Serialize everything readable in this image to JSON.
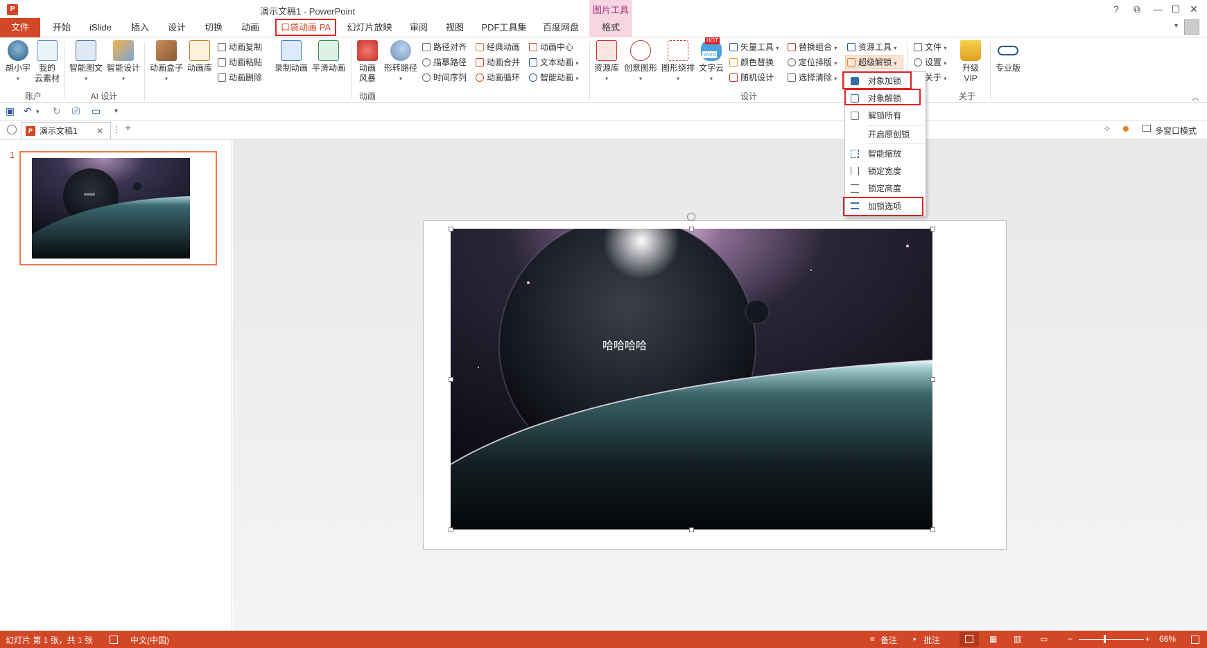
{
  "titlebar": {
    "title": "演示文稿1 - PowerPoint",
    "context_tab": "图片工具",
    "app_icon": "P"
  },
  "window_controls": {
    "help": "?",
    "restore_ribbon": "⧉",
    "minimize": "—",
    "maximize": "☐",
    "close": "✕"
  },
  "tabs": [
    "文件",
    "开始",
    "iSlide",
    "插入",
    "设计",
    "切换",
    "动画",
    "口袋动画 PA",
    "幻灯片放映",
    "审阅",
    "视图",
    "PDF工具集",
    "百度网盘",
    "格式"
  ],
  "ribbon": {
    "account": {
      "user": "胡小宇",
      "cloud_line1": "我的",
      "cloud_line2": "云素材",
      "group": "账户"
    },
    "ai": {
      "smart_text": "智能图文",
      "smart_design": "智能设计",
      "group": "AI 设计"
    },
    "anim": {
      "box": "动画盒子",
      "lib": "动画库",
      "copy": "动画复制",
      "paste": "动画粘贴",
      "del": "动画删除",
      "record": "录制动画",
      "smooth": "平滑动画",
      "storm_line1": "动画",
      "storm_line2": "风暴",
      "path": "形转路径",
      "align": "路径对齐",
      "trace": "描摹路径",
      "timeline": "时间序列",
      "classic": "经典动画",
      "merge": "动画合并",
      "loop": "动画循环",
      "center": "动画中心",
      "text": "文本动画",
      "smart": "智能动画",
      "group": "动画"
    },
    "design": {
      "res": "资源库",
      "creative": "创意图形",
      "shape": "图形绕排",
      "word": "文字云",
      "hot": "HOT",
      "word_badge": "word",
      "vector": "矢量工具",
      "color": "颜色替换",
      "random": "随机设计",
      "replace": "替换组合",
      "locate": "定位排版",
      "clear": "选择清除",
      "restool": "资源工具",
      "unlock": "超级解锁",
      "group": "设计"
    },
    "about": {
      "file": "文件",
      "settings": "设置",
      "about": "关于",
      "vip_line1": "升级",
      "vip_line2": "VIP",
      "pro": "专业版",
      "group": "关于"
    }
  },
  "doc_tab": {
    "name": "演示文稿1",
    "close": "✕",
    "more": "⋮",
    "add": "+",
    "multiwin": "多窗口模式"
  },
  "dropdown": [
    "对象加锁",
    "对象解锁",
    "解锁所有",
    "开启原创锁",
    "智能缩放",
    "锁定宽度",
    "锁定高度",
    "加锁选项"
  ],
  "slide": {
    "number": "1",
    "text": "哈哈哈哈",
    "thumb_text": "哈哈哈哈"
  },
  "status": {
    "slide_info": "幻灯片 第 1 张，共 1 张",
    "lang": "中文(中国)",
    "notes": "备注",
    "comments": "批注",
    "zoom": "66%"
  },
  "colors": {
    "accent": "#d24726",
    "highlight": "#e02020",
    "context": "#f7d6e3"
  }
}
